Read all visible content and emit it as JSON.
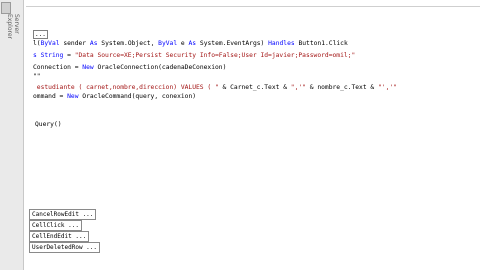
{
  "sidebar": {
    "label": "Server Explorer"
  },
  "editor": {
    "collapsed_marker": "...",
    "lines": [
      {
        "parts": [
          {
            "t": "plain",
            "v": "l("
          },
          {
            "t": "kw",
            "v": "ByVal"
          },
          {
            "t": "plain",
            "v": " sender "
          },
          {
            "t": "kw",
            "v": "As"
          },
          {
            "t": "plain",
            "v": " System.Object, "
          },
          {
            "t": "kw",
            "v": "ByVal"
          },
          {
            "t": "plain",
            "v": " e "
          },
          {
            "t": "kw",
            "v": "As"
          },
          {
            "t": "plain",
            "v": " System.EventArgs) "
          },
          {
            "t": "kw",
            "v": "Handles"
          },
          {
            "t": "plain",
            "v": " Button1.Click"
          }
        ]
      },
      {
        "parts": [
          {
            "t": "kw",
            "v": "s String"
          },
          {
            "t": "plain",
            "v": " = "
          },
          {
            "t": "str",
            "v": "\"Data Source=XE;Persist Security Info=False;User Id=javier;Password=omil;\""
          }
        ]
      },
      {
        "parts": [
          {
            "t": "plain",
            "v": "Connection = "
          },
          {
            "t": "kw",
            "v": "New"
          },
          {
            "t": "plain",
            "v": " OracleConnection(cadenaDeConexion)"
          }
        ]
      },
      {
        "parts": [
          {
            "t": "plain",
            "v": "\"\""
          }
        ]
      },
      {
        "parts": [
          {
            "t": "str",
            "v": " estudiante ( carnet,nombre,direccion) VALUES ( \""
          },
          {
            "t": "plain",
            "v": " & Carnet_c.Text & "
          },
          {
            "t": "str",
            "v": "\",'\""
          },
          {
            "t": "plain",
            "v": " & nombre_c.Text & "
          },
          {
            "t": "str",
            "v": "\"','\""
          }
        ]
      },
      {
        "parts": [
          {
            "t": "plain",
            "v": "ommand = "
          },
          {
            "t": "kw",
            "v": "New"
          },
          {
            "t": "plain",
            "v": " OracleCommand(query, conexion)"
          }
        ]
      },
      {
        "parts": [
          {
            "t": "plain",
            "v": ""
          }
        ]
      },
      {
        "parts": [
          {
            "t": "plain",
            "v": ""
          }
        ]
      },
      {
        "parts": [
          {
            "t": "plain",
            "v": "Query()"
          }
        ]
      }
    ]
  },
  "event_tabs": [
    {
      "label": "CancelRowEdit ..."
    },
    {
      "label": "CellClick ..."
    },
    {
      "label": "CellEndEdit ..."
    },
    {
      "label": "UserDeletedRow ..."
    }
  ]
}
